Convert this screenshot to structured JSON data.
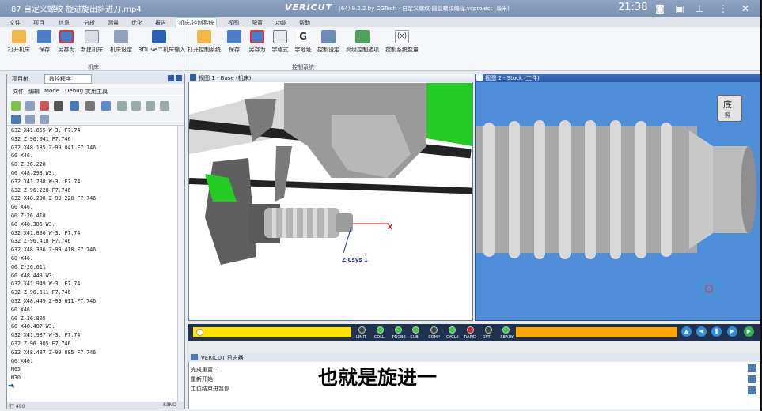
{
  "video_title": "87 自定义螺纹 旋进旋出斜进刀.mp4",
  "logo": "VERICUT",
  "app_title": "(64) 9.2.2 by CGTech - 自定义螺纹-圆弧螺纹编程.vcproject (毫米)",
  "clock": "21:38",
  "menus": [
    "文件",
    "项目",
    "信息",
    "分析",
    "测量",
    "优化",
    "报告",
    "机床/控制系统",
    "视图",
    "配置",
    "功能",
    "帮助"
  ],
  "ribbon": {
    "machine": [
      "打开机床",
      "保存",
      "另存为",
      "新建机床",
      "机床设定",
      "3DLive™机床输入"
    ],
    "control": [
      "打开控制系统",
      "保存",
      "另存为",
      "字格式",
      "字地址",
      "控制设定",
      "高级控制选项",
      "控制系统变量"
    ],
    "group_machine": "机床",
    "group_control": "控制系统"
  },
  "left_tabs": [
    "项目树",
    "数控程序"
  ],
  "code_menu": [
    "文件",
    "编辑",
    "Mode",
    "Debug",
    "实用工具"
  ],
  "code_lines": [
    "G32 X41.665 W-3. F7.74",
    "G32 Z-96.041 F7.746",
    "G32 X48.185 Z-99.041 F7.746",
    "G0 X46.",
    "G0 Z-26.228",
    "G0 X48.298 W3.",
    "G32 X41.798 W-3. F7.74",
    "G32 Z-96.228 F7.746",
    "G32 X48.298 Z-99.228 F7.746",
    "G0 X46.",
    "G0 Z-26.418",
    "G0 X48.386 W3.",
    "G32 X41.886 W-3. F7.74",
    "G32 Z-96.418 F7.746",
    "G32 X48.386 Z-99.418 F7.746",
    "G0 X46.",
    "G0 Z-26.611",
    "G0 X48.449 W3.",
    "G32 X41.949 W-3. F7.74",
    "G32 Z-96.611 F7.746",
    "G32 X48.449 Z-99.611 F7.746",
    "G0 X46.",
    "G0 Z-26.805",
    "G0 X48.487 W3.",
    "G32 X41.987 W-3. F7.74",
    "G32 Z-96.805 F7.746",
    "G32 X48.487 Z-99.805 F7.746",
    "G0 X46.",
    "M05",
    "M30",
    "%"
  ],
  "status_left": "行 490",
  "status_right": "83NC",
  "view1_title": "视图 1 - Base (机床)",
  "view2_title": "视图 2 - Stock (工件)",
  "axis_x": "X",
  "axis_z": "Z Csys 1",
  "view_cube_top": "底",
  "view_cube_bottom": "照",
  "leds": [
    "LIMIT",
    "COLL",
    "PROBE",
    "SUB",
    "COMP",
    "CYCLE",
    "RAPID",
    "OPTI",
    "READY"
  ],
  "led_colors": [
    "#3a4a3a",
    "#33cc33",
    "#33cc33",
    "#33cc33",
    "#3a4a3a",
    "#33cc33",
    "#cc2222",
    "#3a4a3a",
    "#33cc33"
  ],
  "log_title": "VERICUT 日志器",
  "log_lines": [
    "完成重置...",
    "重新开始",
    "工位结束进暂停"
  ],
  "subtitle": "也就是旋进一"
}
